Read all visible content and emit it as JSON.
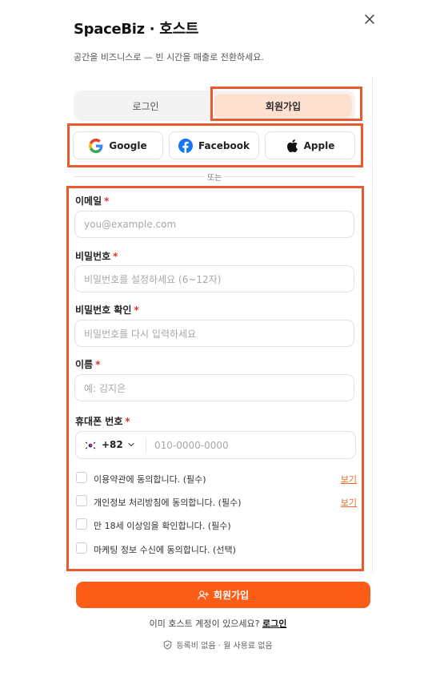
{
  "header": {
    "title": "SpaceBiz · 호스트",
    "subtitle": "공간을 비즈니스로 — 빈 시간을 매출로 전환하세요."
  },
  "tabs": [
    {
      "label": "로그인",
      "active": false
    },
    {
      "label": "회원가입",
      "active": true
    }
  ],
  "social": {
    "google": "Google",
    "facebook": "Facebook",
    "apple": "Apple"
  },
  "or_text": "또는",
  "form": {
    "email": {
      "label": "이메일",
      "placeholder": "you@example.com",
      "required": true
    },
    "password": {
      "label": "비밀번호",
      "placeholder": "비밀번호를 설정하세요 (6~12자)",
      "required": true
    },
    "password_confirm": {
      "label": "비밀번호 확인",
      "placeholder": "비밀번호를 다시 입력하세요",
      "required": true
    },
    "name": {
      "label": "이름",
      "placeholder": "예: 김지은",
      "required": true
    },
    "phone": {
      "label": "휴대폰 번호",
      "dial_code": "+82",
      "placeholder": "010-0000-0000",
      "required": true
    },
    "required_mark": "*"
  },
  "agreements": [
    {
      "text": "이용약관에 동의합니다. (필수)",
      "link": "보기",
      "checked": false
    },
    {
      "text": "개인정보 처리방침에 동의합니다. (필수)",
      "link": "보기",
      "checked": false
    },
    {
      "text": "만 18세 이상임을 확인합니다. (필수)",
      "checked": false
    },
    {
      "text": "마케팅 정보 수신에 동의합니다. (선택)",
      "checked": false
    }
  ],
  "submit_label": "회원가입",
  "login_prompt": {
    "text": "이미 호스트 계정이 있으세요?",
    "link": "로그인"
  },
  "footer_note": "등록비 없음 · 월 사용료 없음",
  "colors": {
    "accent": "#fd5c16",
    "highlight": "#ea5a2e",
    "active_tab": "#fde0cf",
    "required": "#e03131"
  },
  "icons": [
    "close-icon",
    "google-icon",
    "facebook-icon",
    "apple-icon",
    "korea-flag-icon",
    "chevron-down-icon",
    "add-user-icon",
    "shield-icon"
  ]
}
